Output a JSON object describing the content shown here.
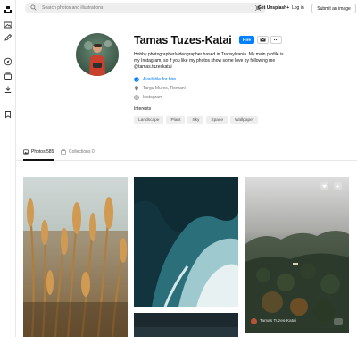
{
  "header": {
    "search_placeholder": "Search photos and illustrations",
    "get_unsplash_label": "Get Unsplash+",
    "login_label": "Log in",
    "submit_label": "Submit an image"
  },
  "sidebar": {
    "items": [
      {
        "icon": "unsplash-logo-icon"
      },
      {
        "icon": "images-icon"
      },
      {
        "icon": "pen-icon"
      },
      {
        "icon": "compass-icon"
      },
      {
        "icon": "collections-icon"
      },
      {
        "icon": "download-icon"
      },
      {
        "icon": "bookmark-icon"
      }
    ]
  },
  "profile": {
    "name": "Tamas Tuzes-Katai",
    "hire_label": "Hire",
    "bio": "Hobby photographer/videographer based in Transylvania. My main profile is my Instagram, so if you like my photos show some love by following me @tamas.tuzeskatai",
    "available_label": "Available for hire",
    "location": "Targu Mures, Romani",
    "instagram": "Instagram",
    "interests_heading": "Interests",
    "interests": [
      "Landscape",
      "Plant",
      "Sky",
      "Space",
      "Wallpaper"
    ]
  },
  "tabs": {
    "photos_label": "Photos 585",
    "collections_label": "Collections 0"
  },
  "photos": {
    "author_name": "Tamas Tuzes-Katai"
  },
  "colors": {
    "accent": "#007fff",
    "tag_bg": "#eeeeee",
    "muted_text": "#767676"
  }
}
